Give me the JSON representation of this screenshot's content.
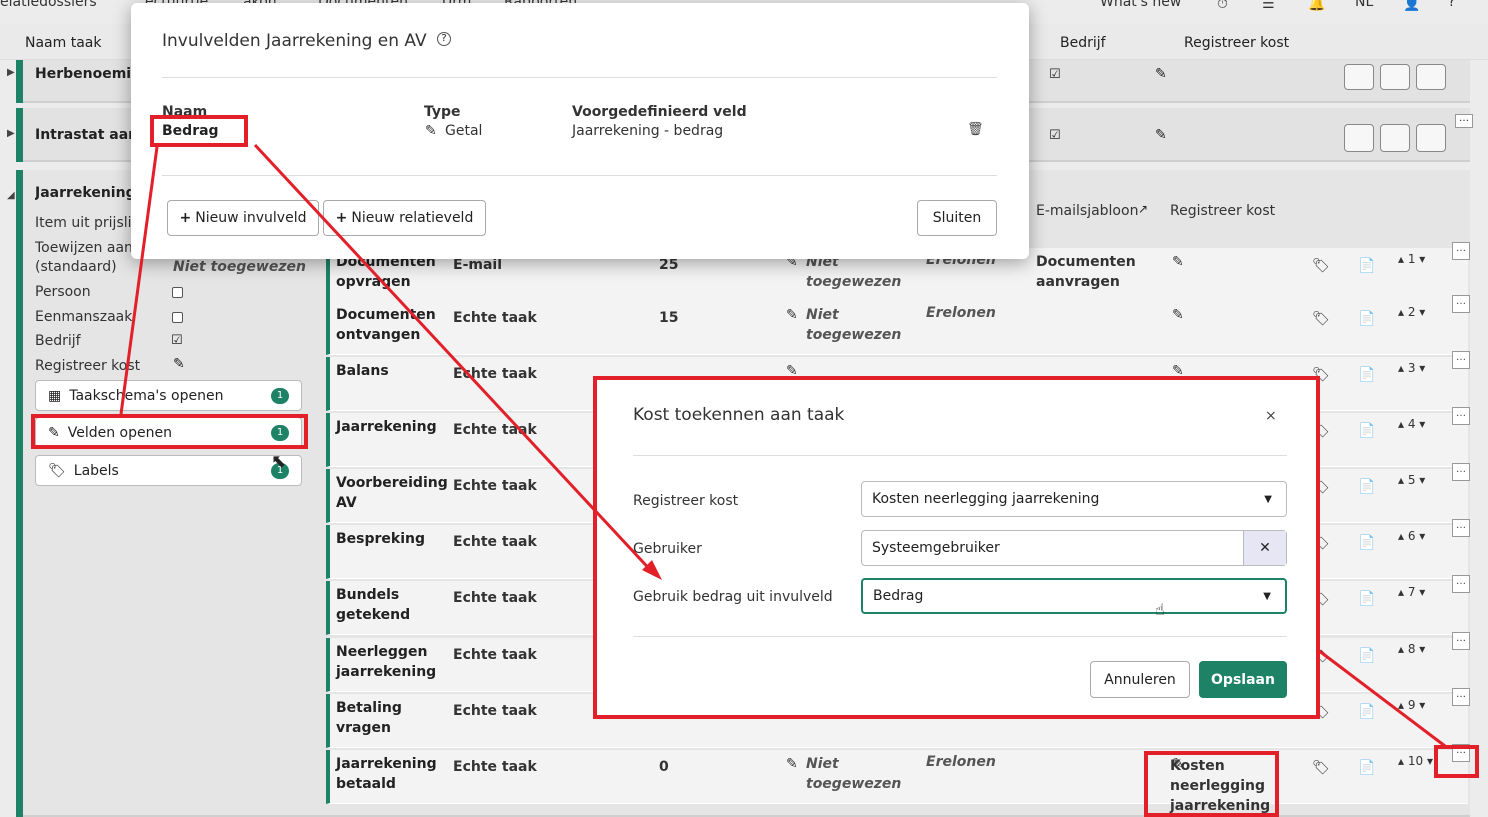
{
  "nav": {
    "items": [
      "elatiedossiers",
      "ectuurtie",
      "akon",
      "Documenten",
      "Urm",
      "Rapporten",
      "What's new",
      "NL"
    ]
  },
  "header": {
    "naam_taak": "Naam taak",
    "bedrijf": "Bedrijf",
    "registreer_kost": "Registreer kost"
  },
  "groups": {
    "g1": "Herbenoeming",
    "g2": "Intrastat aangifte",
    "g3": "Jaarrekening"
  },
  "sidebar": {
    "prijslijst": "Item uit prijslijst",
    "toewijzen": "Toewijzen aan",
    "standaard": "(standaard)",
    "niet_toegewezen": "Niet toegewezen",
    "persoon": "Persoon",
    "eenmanszaak": "Eenmanszaak",
    "bedrijf": "Bedrijf",
    "registreer_kost": "Registreer kost",
    "btn_taakschema": "Taakschema's openen",
    "btn_velden": "Velden openen",
    "btn_labels": "Labels",
    "badge_taakschema": "1",
    "badge_velden": "1",
    "badge_labels": "1"
  },
  "subheader": {
    "emailsjabloon": "E-mailsjabloon",
    "registreer_kost": "Registreer kost"
  },
  "rows": [
    {
      "name": "Documenten opvragen",
      "type": "E-mail",
      "num": "25",
      "assignee": "Niet toegewezen",
      "cat": "Erelonen",
      "template": "Documenten aanvragen",
      "cost": "",
      "order": "1"
    },
    {
      "name": "Documenten ontvangen",
      "type": "Echte taak",
      "num": "15",
      "assignee": "Niet toegewezen",
      "cat": "Erelonen",
      "template": "",
      "cost": "",
      "order": "2"
    },
    {
      "name": "Balans",
      "type": "Echte taak",
      "num": "",
      "assignee": "",
      "cat": "",
      "template": "",
      "cost": "",
      "order": "3"
    },
    {
      "name": "Jaarrekening",
      "type": "Echte taak",
      "num": "",
      "assignee": "",
      "cat": "",
      "template": "",
      "cost": "",
      "order": "4"
    },
    {
      "name": "Voorbereiding AV",
      "type": "Echte taak",
      "num": "",
      "assignee": "",
      "cat": "",
      "template": "",
      "cost": "",
      "order": "5"
    },
    {
      "name": "Bespreking",
      "type": "Echte taak",
      "num": "",
      "assignee": "",
      "cat": "",
      "template": "",
      "cost": "",
      "order": "6"
    },
    {
      "name": "Bundels getekend",
      "type": "Echte taak",
      "num": "",
      "assignee": "",
      "cat": "",
      "template": "",
      "cost": "",
      "order": "7"
    },
    {
      "name": "Neerleggen jaarrekening",
      "type": "Echte taak",
      "num": "",
      "assignee": "",
      "cat": "",
      "template": "",
      "cost": "",
      "order": "8"
    },
    {
      "name": "Betaling vragen",
      "type": "Echte taak",
      "num": "",
      "assignee": "",
      "cat": "",
      "template": "",
      "cost": "",
      "order": "9"
    },
    {
      "name": "Jaarrekening betaald",
      "type": "Echte taak",
      "num": "0",
      "assignee": "Niet toegewezen",
      "cat": "Erelonen",
      "template": "",
      "cost": "Kosten neerlegging jaarrekening",
      "order": "10"
    }
  ],
  "fields_modal": {
    "title": "Invulvelden Jaarrekening en AV",
    "col_naam": "Naam",
    "col_type": "Type",
    "col_voorgedefinieerd": "Voorgedefinieerd veld",
    "row_naam": "Bedrag",
    "row_type": "Getal",
    "row_veld": "Jaarrekening - bedrag",
    "btn_nieuw_invulveld": "Nieuw invulveld",
    "btn_nieuw_relatieveld": "Nieuw relatieveld",
    "btn_sluiten": "Sluiten"
  },
  "cost_modal": {
    "title": "Kost toekennen aan taak",
    "close": "×",
    "lbl_registreer": "Registreer kost",
    "val_registreer": "Kosten neerlegging jaarrekening",
    "lbl_gebruiker": "Gebruiker",
    "val_gebruiker": "Systeemgebruiker",
    "lbl_bedrag": "Gebruik bedrag uit invulveld",
    "val_bedrag": "Bedrag",
    "btn_annuleren": "Annuleren",
    "btn_opslaan": "Opslaan"
  },
  "colors": {
    "accent": "#1e8366",
    "highlight": "#e3202a"
  }
}
